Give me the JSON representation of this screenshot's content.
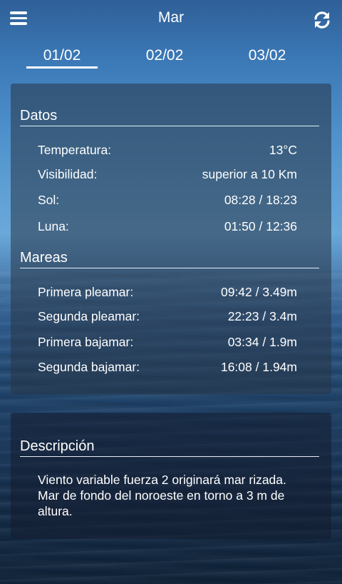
{
  "header": {
    "title": "Mar"
  },
  "tabs": [
    {
      "label": "01/02"
    },
    {
      "label": "02/02"
    },
    {
      "label": "03/02"
    }
  ],
  "datos": {
    "title": "Datos",
    "rows": [
      {
        "label": "Temperatura:",
        "value": "13°C"
      },
      {
        "label": "Visibilidad:",
        "value": "superior a 10 Km"
      },
      {
        "label": "Sol:",
        "value": "08:28 / 18:23"
      },
      {
        "label": "Luna:",
        "value": "01:50 / 12:36"
      }
    ]
  },
  "mareas": {
    "title": "Mareas",
    "rows": [
      {
        "label": "Primera pleamar:",
        "value": "09:42 / 3.49m"
      },
      {
        "label": "Segunda pleamar:",
        "value": "22:23 / 3.4m"
      },
      {
        "label": "Primera bajamar:",
        "value": "03:34 / 1.9m"
      },
      {
        "label": "Segunda bajamar:",
        "value": "16:08 / 1.94m"
      }
    ]
  },
  "descripcion": {
    "title": "Descripción",
    "text": "Viento variable fuerza 2 originará mar rizada. Mar de fondo del noroeste en torno a 3 m de altura."
  },
  "icons": {
    "menu": "menu-icon",
    "refresh": "refresh-icon"
  }
}
